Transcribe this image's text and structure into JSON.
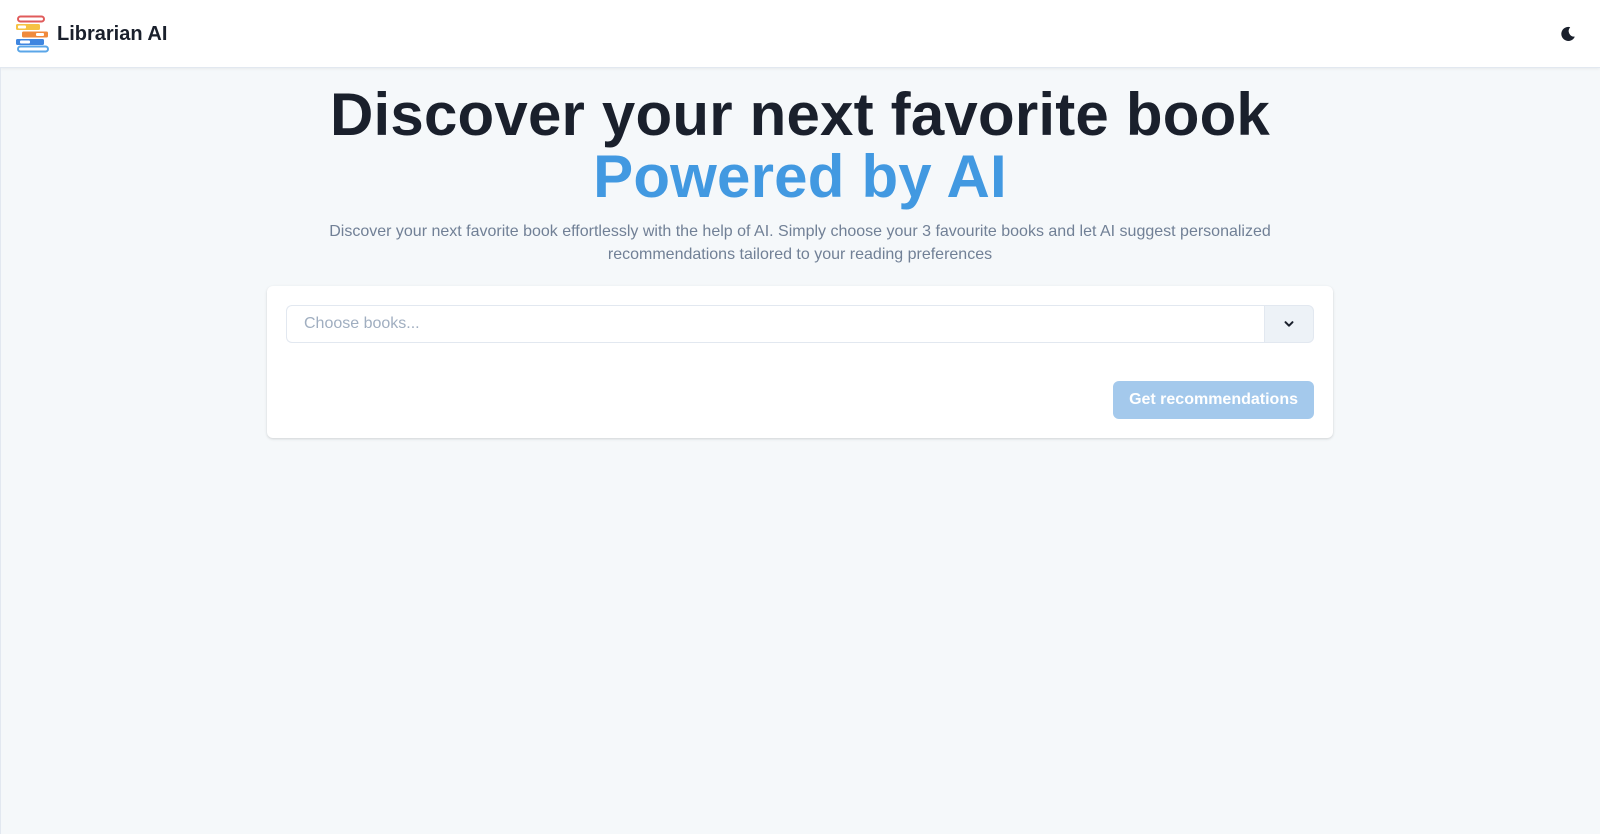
{
  "app": {
    "name": "Librarian AI",
    "logo_icon": "book-stack-icon",
    "theme_toggle_icon": "moon-icon"
  },
  "hero": {
    "title_line1": "Discover your next favorite book",
    "title_line2": "Powered by AI",
    "subtitle": "Discover your next favorite book effortlessly with the help of AI. Simply choose your 3 favourite books and let AI suggest personalized recommendations tailored to your reading preferences"
  },
  "form": {
    "book_select": {
      "placeholder": "Choose books...",
      "value": "",
      "toggle_icon": "chevron-down-icon"
    },
    "submit_label": "Get recommendations",
    "submit_disabled": true
  },
  "colors": {
    "accent": "#4299e1",
    "heading": "#1a202c",
    "muted_text": "#718096",
    "page_bg": "#f5f8fa",
    "disabled_button": "#a4c9ec"
  }
}
